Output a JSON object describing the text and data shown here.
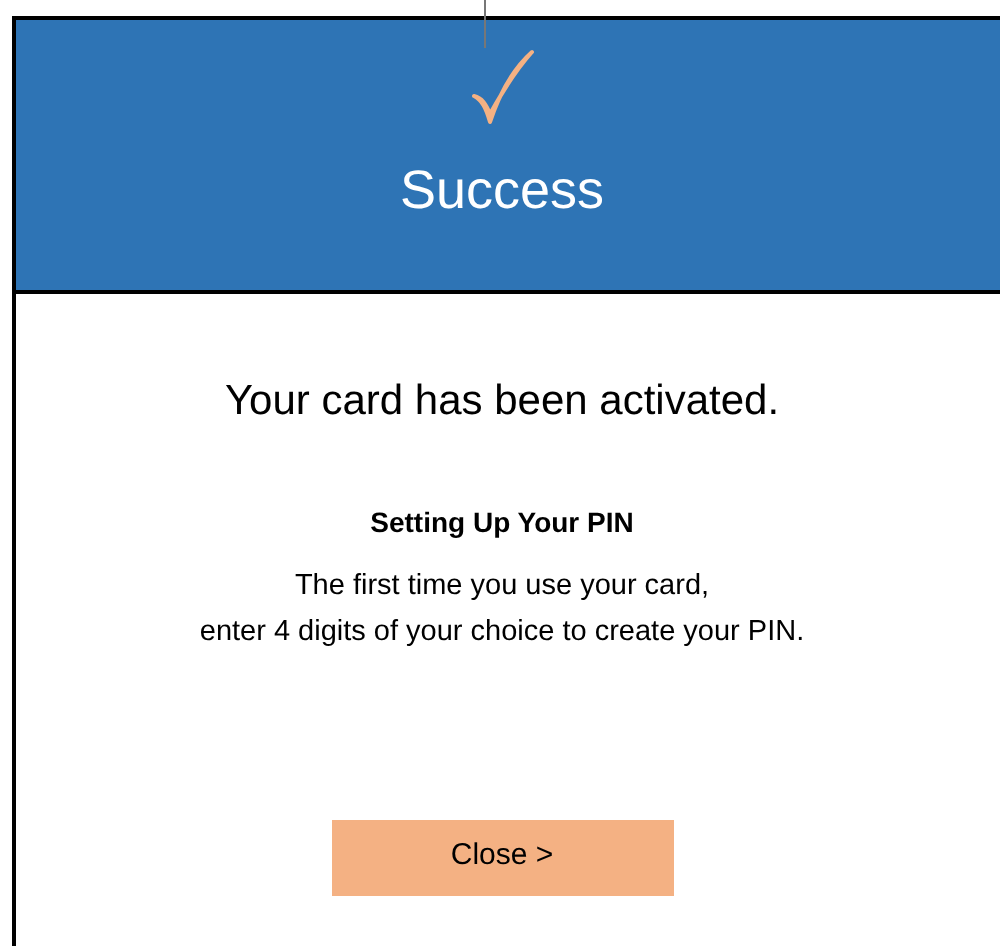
{
  "header": {
    "title": "Success"
  },
  "message": "Your card has been activated.",
  "section": {
    "heading": "Setting Up Your PIN",
    "lines": [
      "The first time you use your card,",
      "enter 4 digits of your choice to create your PIN."
    ]
  },
  "button": {
    "label": "Close >"
  }
}
